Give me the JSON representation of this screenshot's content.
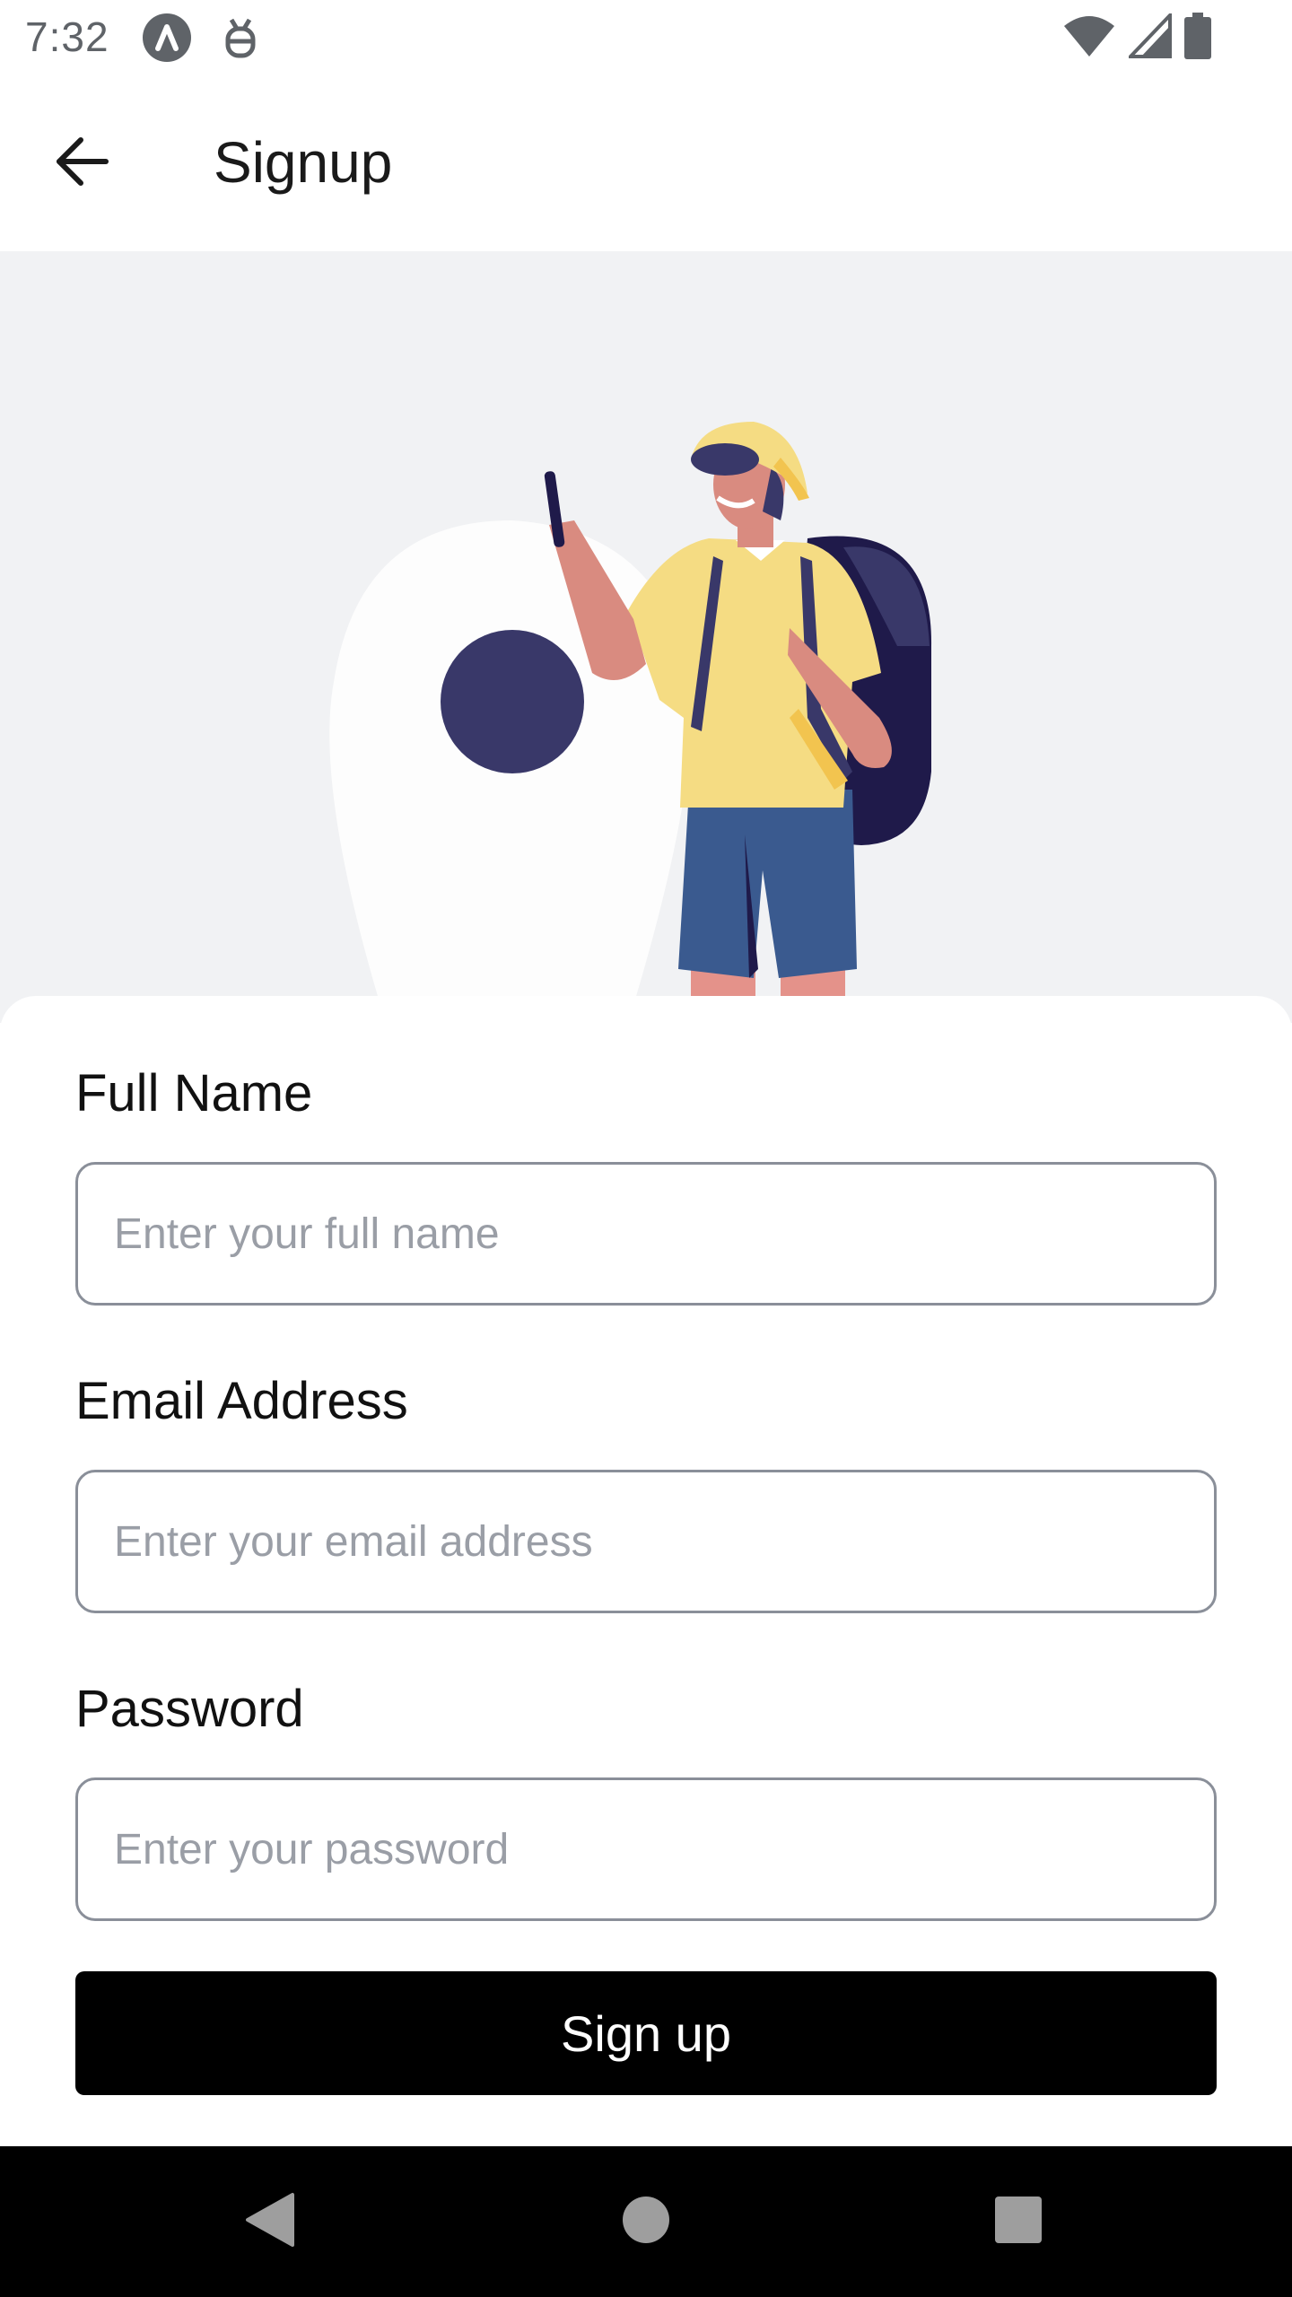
{
  "status_bar": {
    "time": "7:32",
    "icons": [
      "app-a-icon",
      "bug-icon",
      "wifi-icon",
      "signal-icon",
      "battery-icon"
    ]
  },
  "app_bar": {
    "title": "Signup",
    "back_icon": "arrow-left-icon"
  },
  "form": {
    "full_name": {
      "label": "Full Name",
      "placeholder": "Enter your full name",
      "value": ""
    },
    "email": {
      "label": "Email Address",
      "placeholder": "Enter your email address",
      "value": ""
    },
    "password": {
      "label": "Password",
      "placeholder": "Enter your password",
      "value": ""
    },
    "submit_label": "Sign up"
  },
  "nav_bar": {
    "icons": [
      "back-triangle-icon",
      "home-circle-icon",
      "recents-square-icon"
    ]
  },
  "colors": {
    "hero_background": "#f1f2f4",
    "button": "#000000",
    "input_border": "#8a8f99",
    "placeholder": "#9a9ea6",
    "illustration_navy": "#393869",
    "illustration_yellow": "#f5dc83",
    "illustration_blue": "#3a5a8f",
    "illustration_skin": "#d98b80"
  }
}
